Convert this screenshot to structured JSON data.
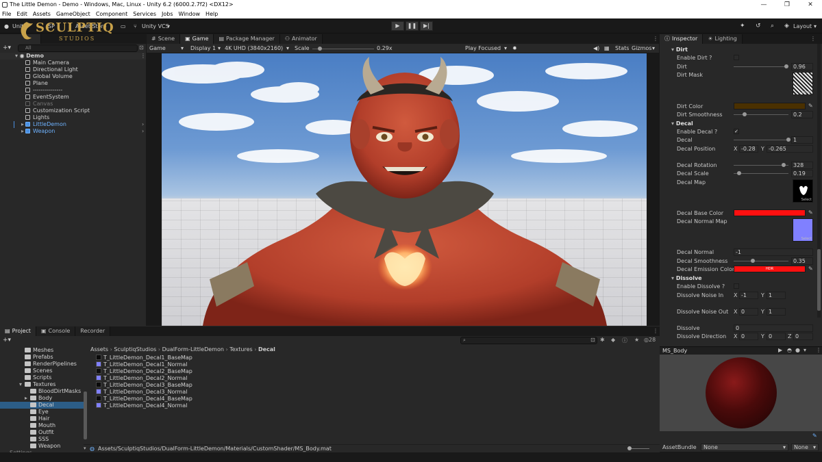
{
  "window": {
    "title": "The Little Demon - Demo - Windows, Mac, Linux - Unity 6.2 (6000.2.7f2) <DX12>",
    "controls": [
      "—",
      "❐",
      "✕"
    ]
  },
  "menu": [
    "File",
    "Edit",
    "Assets",
    "GameObject",
    "Component",
    "Services",
    "Jobs",
    "Window",
    "Help"
  ],
  "toolbar": {
    "unity_label": "Unity",
    "sp_label": "SP",
    "asset_store_label": "Asset Store",
    "vcs_label": "Unity VCS",
    "layout_label": "Layout",
    "logo_text": "SCULPTIQ",
    "logo_sub": "STUDIOS"
  },
  "scene_tabs": [
    "Scene",
    "Game",
    "Package Manager",
    "Animator"
  ],
  "hierarchy": {
    "search_placeholder": "All",
    "scene_name": "Demo",
    "items": [
      {
        "label": "Main Camera",
        "style": "normal"
      },
      {
        "label": "Directional Light",
        "style": "normal"
      },
      {
        "label": "Global Volume",
        "style": "normal"
      },
      {
        "label": "Plane",
        "style": "normal"
      },
      {
        "label": "---------------",
        "style": "normal"
      },
      {
        "label": "EventSystem",
        "style": "normal"
      },
      {
        "label": "Canvas",
        "style": "dim"
      },
      {
        "label": "Customization Script",
        "style": "normal"
      },
      {
        "label": "Lights",
        "style": "normal"
      },
      {
        "label": "LittleDemon",
        "style": "prefab"
      },
      {
        "label": "Weapon",
        "style": "prefab"
      }
    ]
  },
  "game_bar": {
    "mode": "Game",
    "display": "Display 1",
    "resolution": "4K UHD (3840x2160)",
    "scale_label": "Scale",
    "scale_value": "0.29x",
    "scale_fraction": 0.12,
    "play_focused": "Play Focused",
    "stats": "Stats",
    "gizmos": "Gizmos"
  },
  "inspector": {
    "tabs": [
      "Inspector",
      "Lighting"
    ],
    "dirt": {
      "header": "Dirt",
      "enable_label": "Enable Dirt ?",
      "enable": false,
      "dirt_label": "Dirt",
      "dirt_value": "0.96",
      "dirt_fraction": 0.96,
      "mask_label": "Dirt Mask",
      "color_label": "Dirt Color",
      "color": "#4a3000",
      "smooth_label": "Dirt Smoothness",
      "smooth_value": "0.2",
      "smooth_fraction": 0.2
    },
    "decal": {
      "header": "Decal",
      "enable_label": "Enable Decal ?",
      "enable": true,
      "decal_label": "Decal",
      "decal_value": "1",
      "decal_fraction": 1.0,
      "pos_label": "Decal Position",
      "pos_x": "-0.28",
      "pos_y": "-0.265",
      "rot_label": "Decal Rotation",
      "rot_value": "328",
      "rot_fraction": 0.91,
      "scale_label": "Decal Scale",
      "scale_value": "0.19",
      "scale_fraction": 0.1,
      "map_label": "Decal Map",
      "base_color_label": "Decal Base Color",
      "base_color": "#ff1010",
      "normal_map_label": "Decal Normal Map",
      "normal_label": "Decal Normal",
      "normal_value": "-1",
      "smooth_label": "Decal Smoothness",
      "smooth_value": "0.35",
      "smooth_fraction": 0.35,
      "emission_label": "Decal Emission Color",
      "emission_color": "#ff1010",
      "hdr": "HDR"
    },
    "dissolve": {
      "header": "Dissolve",
      "enable_label": "Enable Dissolve ?",
      "noise_in_label": "Dissolve Noise In",
      "noise_in_x": "-1",
      "noise_in_y": "1",
      "noise_out_label": "Dissolve Noise Out",
      "noise_out_x": "0",
      "noise_out_y": "1",
      "dissolve_label": "Dissolve",
      "dissolve_value": "0",
      "direction_label": "Dissolve Direction",
      "dir_x": "0",
      "dir_y": "0",
      "dir_z": "0"
    },
    "select_label": "Select",
    "axis_x": "X",
    "axis_y": "Y",
    "axis_z": "Z"
  },
  "preview": {
    "title": "MS_Body",
    "assetbundle_label": "AssetBundle",
    "assetbundle_value": "None",
    "variant_value": "None"
  },
  "bottom_tabs": [
    "Project",
    "Console",
    "Recorder"
  ],
  "project": {
    "tree": [
      {
        "label": "Meshes",
        "indent": 1,
        "selected": false
      },
      {
        "label": "Prefabs",
        "indent": 1,
        "selected": false
      },
      {
        "label": "RenderPipelines",
        "indent": 1,
        "selected": false
      },
      {
        "label": "Scenes",
        "indent": 1,
        "selected": false
      },
      {
        "label": "Scripts",
        "indent": 1,
        "selected": false
      },
      {
        "label": "Textures",
        "indent": 1,
        "selected": false
      },
      {
        "label": "BloodDirtMasks",
        "indent": 2,
        "selected": false
      },
      {
        "label": "Body",
        "indent": 2,
        "selected": false
      },
      {
        "label": "Decal",
        "indent": 2,
        "selected": true
      },
      {
        "label": "Eye",
        "indent": 2,
        "selected": false
      },
      {
        "label": "Hair",
        "indent": 2,
        "selected": false
      },
      {
        "label": "Mouth",
        "indent": 2,
        "selected": false
      },
      {
        "label": "Outfit",
        "indent": 2,
        "selected": false
      },
      {
        "label": "SSS",
        "indent": 2,
        "selected": false
      },
      {
        "label": "Weapon",
        "indent": 2,
        "selected": false
      }
    ],
    "bottom_partial": "Settings",
    "breadcrumb": [
      "Assets",
      "SculptiqStudios",
      "DualForm-LittleDemon",
      "Textures",
      "Decal"
    ],
    "files": [
      {
        "name": "T_LittleDemon_Decal1_BaseMap",
        "type": "base"
      },
      {
        "name": "T_LittleDemon_Decal1_Normal",
        "type": "normal"
      },
      {
        "name": "T_LittleDemon_Decal2_BaseMap",
        "type": "base"
      },
      {
        "name": "T_LittleDemon_Decal2_Normal",
        "type": "normal"
      },
      {
        "name": "T_LittleDemon_Decal3_BaseMap",
        "type": "base"
      },
      {
        "name": "T_LittleDemon_Decal3_Normal",
        "type": "normal"
      },
      {
        "name": "T_LittleDemon_Decal4_BaseMap",
        "type": "base"
      },
      {
        "name": "T_LittleDemon_Decal4_Normal",
        "type": "normal"
      }
    ],
    "status_path": "Assets/SculptiqStudios/DualForm-LittleDemon/Materials/CustomShader/MS_Body.mat",
    "count": "28"
  }
}
